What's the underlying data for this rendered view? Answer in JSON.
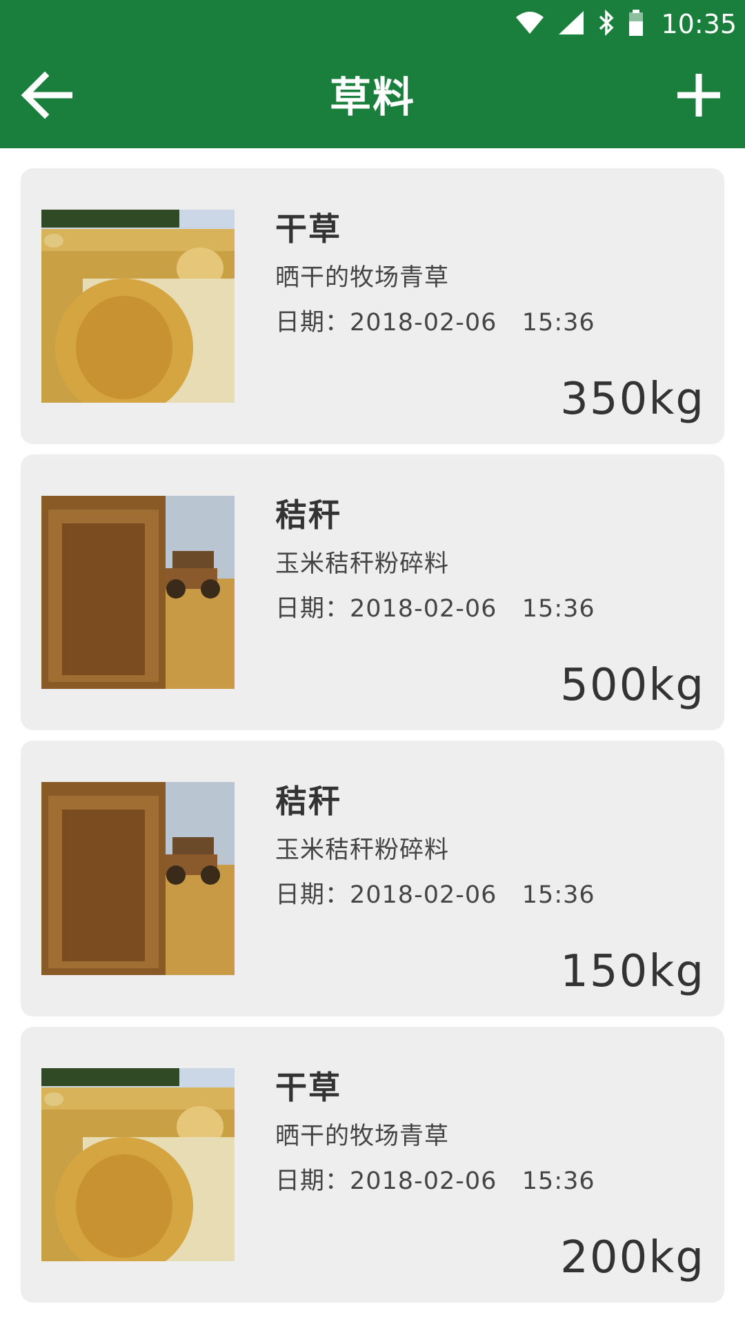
{
  "status_bar": {
    "time": "10:35",
    "icons": [
      "wifi-icon",
      "signal-icon",
      "bluetooth-icon",
      "battery-icon"
    ]
  },
  "header": {
    "title": "草料",
    "back_icon": "arrow-left-icon",
    "add_icon": "plus-icon"
  },
  "colors": {
    "primary": "#1a7f3c",
    "card_bg": "#eeeeee"
  },
  "items": [
    {
      "title": "干草",
      "description": "晒干的牧场青草",
      "date": "日期：2018-02-06   15:36",
      "weight": "350kg",
      "image": "hay-bale-photo"
    },
    {
      "title": "秸秆",
      "description": "玉米秸秆粉碎料",
      "date": "日期：2018-02-06   15:36",
      "weight": "500kg",
      "image": "straw-bale-photo"
    },
    {
      "title": "秸秆",
      "description": "玉米秸秆粉碎料",
      "date": "日期：2018-02-06   15:36",
      "weight": "150kg",
      "image": "straw-bale-photo"
    },
    {
      "title": "干草",
      "description": "晒干的牧场青草",
      "date": "日期：2018-02-06   15:36",
      "weight": "200kg",
      "image": "hay-bale-photo"
    }
  ]
}
